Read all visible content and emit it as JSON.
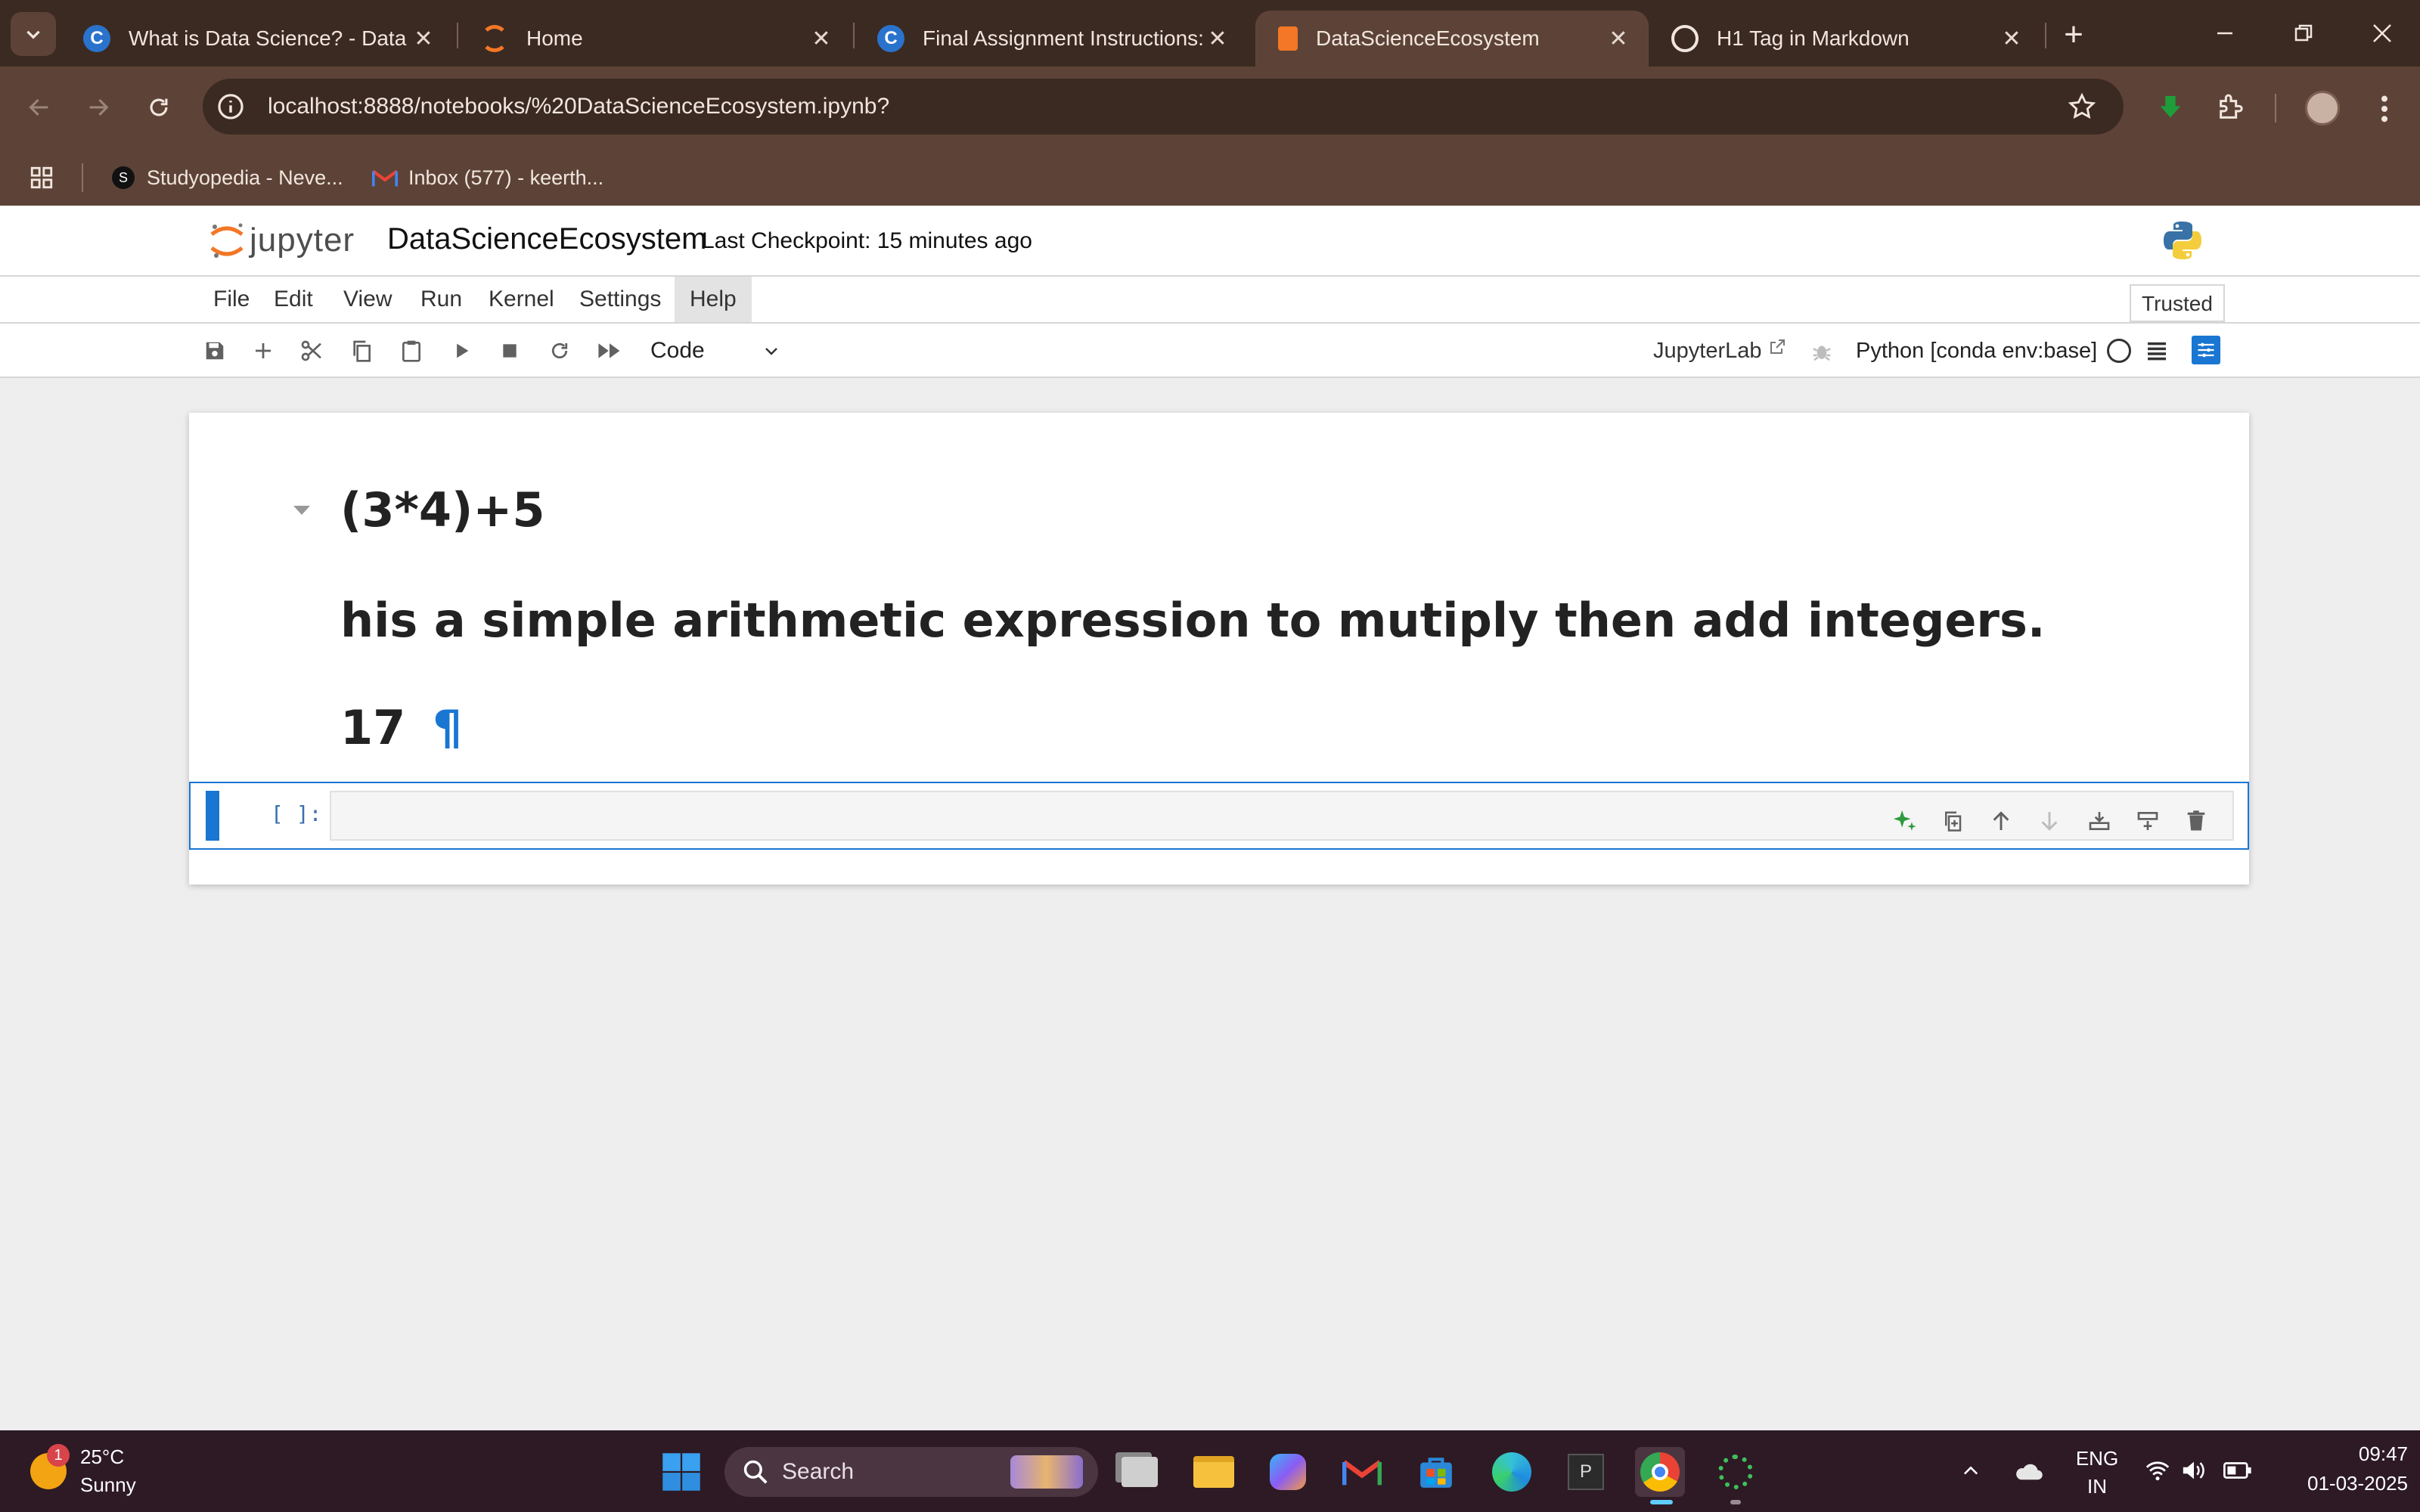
{
  "browser": {
    "tabs": [
      {
        "title": "What is Data Science? - Data Il",
        "icon": "coursera-icon"
      },
      {
        "title": "Home",
        "icon": "jupyter-icon"
      },
      {
        "title": "Final Assignment Instructions:",
        "icon": "coursera-icon"
      },
      {
        "title": "DataScienceEcosystem",
        "icon": "notebook-icon",
        "active": true
      },
      {
        "title": "H1 Tag in Markdown",
        "icon": "openai-icon"
      }
    ],
    "url": "localhost:8888/notebooks/%20DataScienceEcosystem.ipynb?",
    "bookmarks": [
      {
        "label": "Studyopedia - Neve...",
        "icon": "studyopedia-icon"
      },
      {
        "label": "Inbox (577) - keerth...",
        "icon": "gmail-icon"
      }
    ]
  },
  "jupyter": {
    "logo_text": "jupyter",
    "notebook_name": "DataScienceEcosystem",
    "checkpoint": "Last Checkpoint: 15 minutes ago",
    "menu": [
      "File",
      "Edit",
      "View",
      "Run",
      "Kernel",
      "Settings",
      "Help"
    ],
    "trusted": "Trusted",
    "cell_type": "Code",
    "jupyterlab_link": "JupyterLab",
    "kernel_name": "Python [conda env:base]"
  },
  "cells": {
    "markdown": {
      "heading1": "(3*4)+5",
      "heading2": "his a simple arithmetic expression to mutiply then add integers.",
      "heading3": "17",
      "anchor": "¶"
    },
    "code_prompt": "[ ]:"
  },
  "taskbar": {
    "weather_temp": "25°C",
    "weather_desc": "Sunny",
    "weather_badge": "1",
    "search_placeholder": "Search",
    "lang_top": "ENG",
    "lang_bottom": "IN",
    "time": "09:47",
    "date": "01-03-2025"
  },
  "colors": {
    "accent_blue": "#1976d2",
    "jupyter_orange": "#f37726",
    "chrome_dark": "#3b2a22",
    "chrome_mid": "#5d4337",
    "taskbar_bg": "#2d1a25"
  }
}
